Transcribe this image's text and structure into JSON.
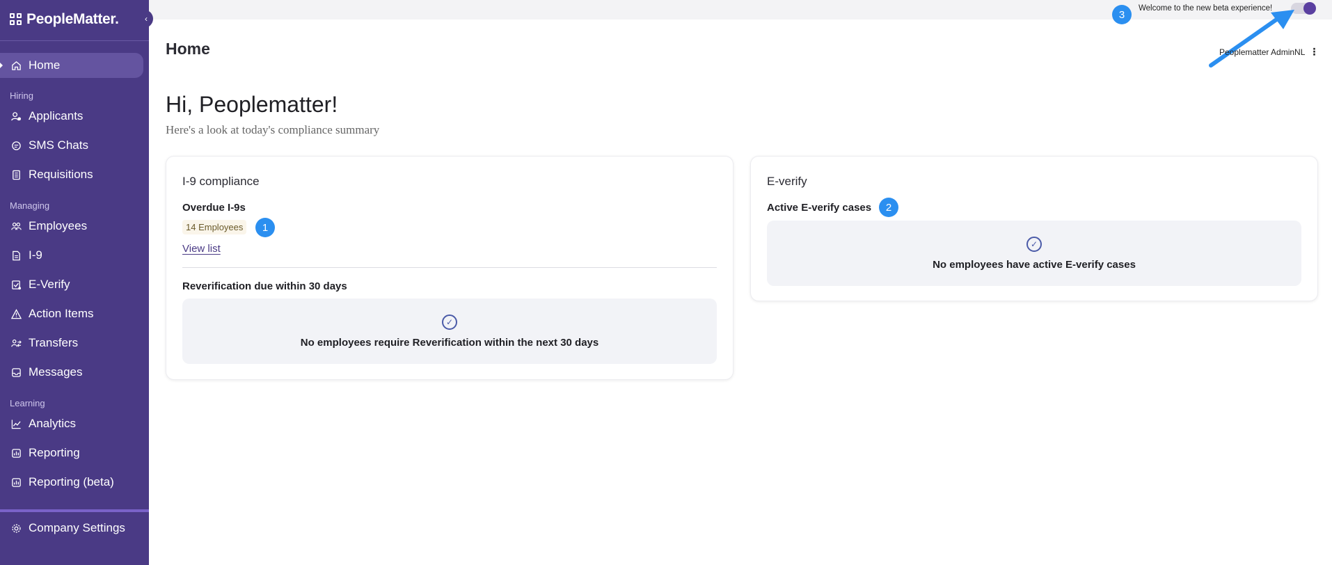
{
  "brand": {
    "name": "PeopleMatter."
  },
  "sidebar": {
    "collapse_icon": "chevron-left-icon",
    "sections": [
      {
        "label": "Hiring"
      },
      {
        "label": "Managing"
      },
      {
        "label": "Learning"
      }
    ],
    "items": [
      {
        "label": "Home",
        "icon": "home-icon",
        "active": true
      },
      {
        "label": "Applicants",
        "icon": "applicants-icon"
      },
      {
        "label": "SMS Chats",
        "icon": "chat-icon"
      },
      {
        "label": "Requisitions",
        "icon": "document-icon"
      },
      {
        "label": "Employees",
        "icon": "employees-icon"
      },
      {
        "label": "I-9",
        "icon": "file-icon"
      },
      {
        "label": "E-Verify",
        "icon": "verify-icon"
      },
      {
        "label": "Action Items",
        "icon": "warning-icon"
      },
      {
        "label": "Transfers",
        "icon": "transfers-icon"
      },
      {
        "label": "Messages",
        "icon": "inbox-icon"
      },
      {
        "label": "Analytics",
        "icon": "chart-icon"
      },
      {
        "label": "Reporting",
        "icon": "report-icon"
      },
      {
        "label": "Reporting (beta)",
        "icon": "report-icon"
      },
      {
        "label": "Company Settings",
        "icon": "gear-icon"
      }
    ]
  },
  "topbar": {
    "beta_text": "Welcome to the new beta experience!",
    "beta_toggle_on": true
  },
  "header": {
    "title": "Home",
    "user_name": "Peoplematter AdminNL",
    "user_menu_icon": "kebab-icon"
  },
  "greeting": {
    "title": "Hi, Peoplematter!",
    "subtitle": "Here's a look at today's compliance summary"
  },
  "i9_card": {
    "title": "I-9 compliance",
    "overdue_heading": "Overdue I-9s",
    "overdue_badge": "14 Employees",
    "view_list": "View list",
    "reverification_heading": "Reverification due within 30 days",
    "reverification_empty": "No employees require Reverification within the next 30 days"
  },
  "everify_card": {
    "title": "E-verify",
    "active_heading": "Active E-verify cases",
    "active_empty": "No employees have active E-verify cases"
  },
  "callouts": [
    "1",
    "2",
    "3"
  ],
  "colors": {
    "sidebar_bg": "#4a3a85",
    "accent": "#5a3fa0",
    "callout": "#2b8ff0"
  }
}
